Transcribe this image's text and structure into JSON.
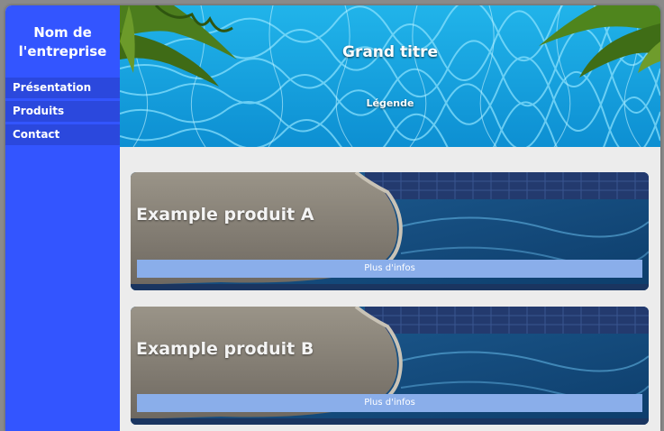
{
  "sidebar": {
    "brand_line1": "Nom de",
    "brand_line2": "l'entreprise",
    "items": [
      {
        "label": "Présentation"
      },
      {
        "label": "Produits"
      },
      {
        "label": "Contact"
      }
    ]
  },
  "hero": {
    "title": "Grand titre",
    "caption": "Légende"
  },
  "products": [
    {
      "title": "Example produit A",
      "button_label": "Plus d'infos"
    },
    {
      "title": "Example produit B",
      "button_label": "Plus d'infos"
    }
  ],
  "colors": {
    "sidebar": "#3355ff",
    "nav_item": "#2b48dd",
    "button": "#8aaeea",
    "page_background": "#ececec"
  }
}
